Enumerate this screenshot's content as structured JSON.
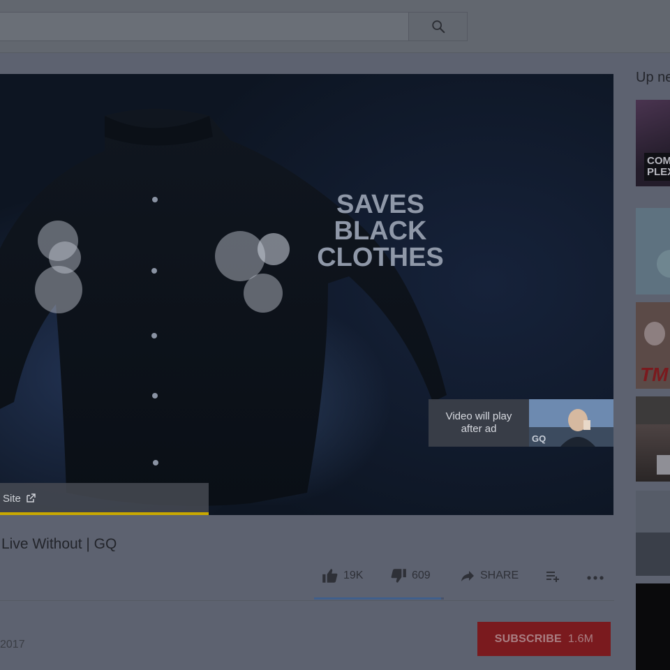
{
  "header": {
    "search": {
      "value": "",
      "placeholder": ""
    },
    "search_icon": "search-icon"
  },
  "player": {
    "ad_headline": [
      "SAVES",
      "BLACK",
      "CLOTHES"
    ],
    "next_card": {
      "line1": "Video will play",
      "line2": "after ad",
      "thumb_logo": "GQ"
    },
    "visit_site_label": "Site",
    "ad_progress_fraction": 0.34
  },
  "video": {
    "title": "Live Without | GQ",
    "date": "2017",
    "likes": "19K",
    "dislikes": "609",
    "share_label": "SHARE",
    "like_fraction": 0.98
  },
  "channel": {
    "subscribe_label": "SUBSCRIBE",
    "subscriber_count": "1.6M"
  },
  "sidebar": {
    "up_next_label": "Up ne",
    "thumb_texts": [
      "COM",
      "PLEX",
      "TM"
    ]
  },
  "colors": {
    "overlay": "#5d6270",
    "subscribe": "#7a1a1e",
    "ad_progress": "#c9a800"
  }
}
